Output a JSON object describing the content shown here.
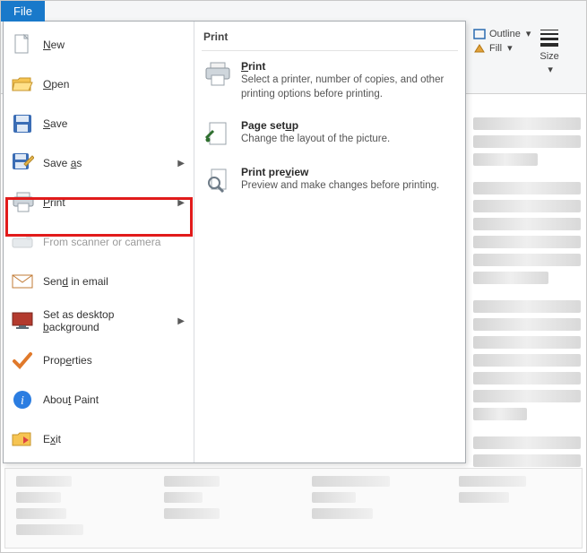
{
  "file_tab": {
    "label": "File"
  },
  "menu": {
    "items": [
      {
        "label": "New",
        "has_submenu": false,
        "disabled": false
      },
      {
        "label": "Open",
        "has_submenu": false,
        "disabled": false
      },
      {
        "label": "Save",
        "has_submenu": false,
        "disabled": false
      },
      {
        "label": "Save as",
        "has_submenu": true,
        "disabled": false
      },
      {
        "label": "Print",
        "has_submenu": true,
        "disabled": false,
        "highlighted": true
      },
      {
        "label": "From scanner or camera",
        "has_submenu": false,
        "disabled": true
      },
      {
        "label": "Send in email",
        "has_submenu": false,
        "disabled": false
      },
      {
        "label": "Set as desktop background",
        "has_submenu": true,
        "disabled": false
      },
      {
        "label": "Properties",
        "has_submenu": false,
        "disabled": false
      },
      {
        "label": "About Paint",
        "has_submenu": false,
        "disabled": false
      },
      {
        "label": "Exit",
        "has_submenu": false,
        "disabled": false
      }
    ],
    "underline_map": {
      "New": "N",
      "Open": "O",
      "Save": "S",
      "Save as": "a",
      "Print": "P",
      "From scanner or camera": "",
      "Send in email": "d",
      "Set as desktop background": "b",
      "Properties": "e",
      "About Paint": "t",
      "Exit": "x"
    }
  },
  "submenu": {
    "header": "Print",
    "items": [
      {
        "title": "Print",
        "desc": "Select a printer, number of copies, and other printing options before printing."
      },
      {
        "title": "Page setup",
        "desc": "Change the layout of the picture."
      },
      {
        "title": "Print preview",
        "desc": "Preview and make changes before printing."
      }
    ],
    "title_underline": {
      "Print": "P",
      "Page setup": "u",
      "Print preview": "v"
    }
  },
  "ribbon": {
    "outline_label": "Outline",
    "fill_label": "Fill",
    "size_label": "Size"
  }
}
